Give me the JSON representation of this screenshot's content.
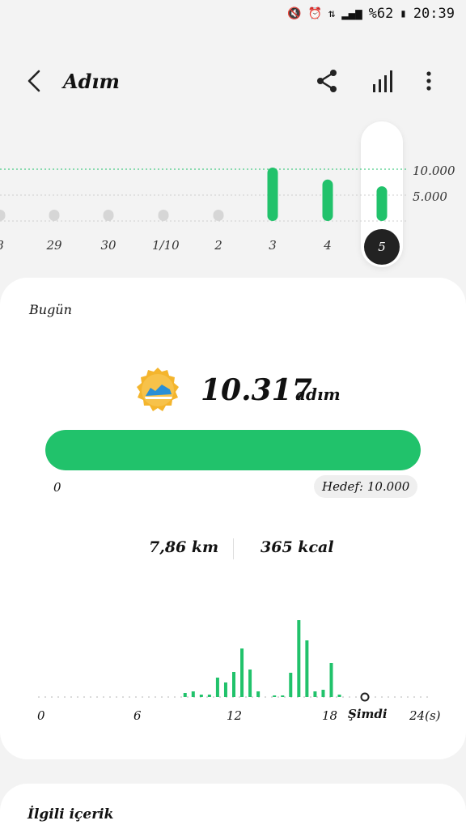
{
  "status_bar": {
    "battery_text": "%62",
    "time": "20:39",
    "icons": [
      "mute-icon",
      "alarm-icon",
      "network-icon",
      "signal-icon",
      "battery-icon"
    ]
  },
  "header": {
    "title": "Adım",
    "back_icon": "chevron-left-icon",
    "share_icon": "share-icon",
    "chart_icon": "bar-chart-icon",
    "more_icon": "more-vertical-icon"
  },
  "history": {
    "days": [
      "8",
      "29",
      "30",
      "1/10",
      "2",
      "3",
      "4",
      "5"
    ],
    "values": [
      1600,
      1500,
      1700,
      400,
      400,
      10317,
      8000,
      6700
    ],
    "goal": 10000,
    "goal_label": "10.000",
    "half_label": "5.000",
    "selected_day": "5",
    "colors": {
      "active": "#21c26b",
      "inactive": "#d6d6d6"
    }
  },
  "today": {
    "label": "Bugün",
    "badge_icon": "sneaker-badge-icon",
    "steps": "10.317",
    "unit": "adım",
    "progress_fraction": 1.0,
    "min_label": "0",
    "goal_label": "Hedef",
    "goal_value": ": 10.000",
    "distance": "7,86 km",
    "calories": "365 kcal",
    "hourly": {
      "hours": [
        9,
        9.5,
        10,
        10.5,
        11,
        11.5,
        12,
        12.5,
        13,
        13.5,
        14,
        14.5,
        15,
        15.5,
        16,
        16.5,
        17,
        17.5,
        18,
        18.5,
        19
      ],
      "values": [
        5,
        7,
        3,
        3,
        24,
        18,
        31,
        60,
        34,
        7,
        0,
        2,
        2,
        30,
        95,
        70,
        7,
        9,
        42,
        3,
        0
      ],
      "axis_labels": [
        "0",
        "6",
        "12",
        "18",
        "Şimdi",
        "24(s)"
      ],
      "accent": "#21c26b"
    }
  },
  "related": {
    "label": "İlgili içerik"
  }
}
